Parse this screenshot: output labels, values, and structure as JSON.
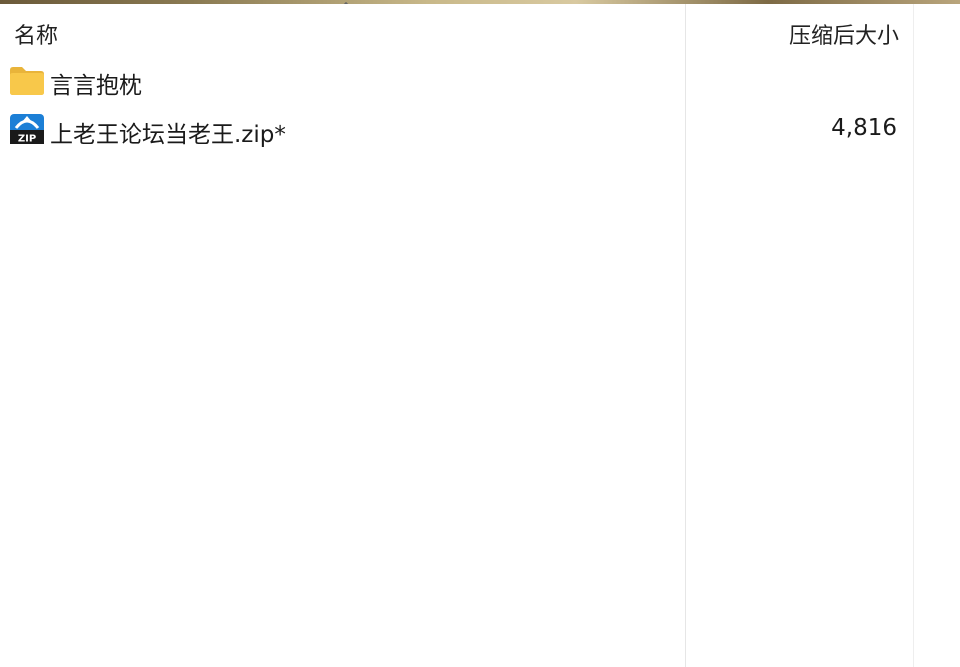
{
  "header": {
    "name_label": "名称",
    "size_label": "压缩后大小"
  },
  "files": [
    {
      "name": "言言抱枕",
      "size": "",
      "icon": "folder-icon"
    },
    {
      "name": "上老王论坛当老王.zip*",
      "size": "4,816",
      "icon": "zip-icon"
    }
  ],
  "colors": {
    "folder": "#F8C84A",
    "zip_blue": "#1C7FD6",
    "text": "#1A1A1A"
  }
}
